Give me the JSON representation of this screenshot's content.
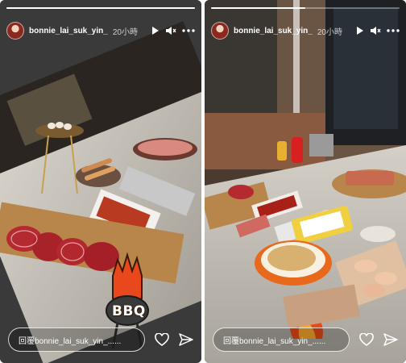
{
  "stories": [
    {
      "username": "bonnie_lai_suk_yin_",
      "time": "20小時",
      "reply_placeholder": "回覆bonnie_lai_suk_yin_......",
      "progress": 1.0,
      "sticker_text": "BBQ",
      "icons": [
        "avatar",
        "play-icon",
        "mute-icon",
        "more-icon",
        "heart-icon",
        "send-icon"
      ]
    },
    {
      "username": "bonnie_lai_suk_yin_",
      "time": "20小時",
      "reply_placeholder": "回覆bonnie_lai_suk_yin_......",
      "progress": 0.5,
      "icons": [
        "avatar",
        "play-icon",
        "mute-icon",
        "more-icon",
        "heart-icon",
        "send-icon"
      ]
    }
  ],
  "colors": {
    "background": "#ffffff",
    "story_bg": "#2a2a2a",
    "accent": "#e8481c"
  }
}
